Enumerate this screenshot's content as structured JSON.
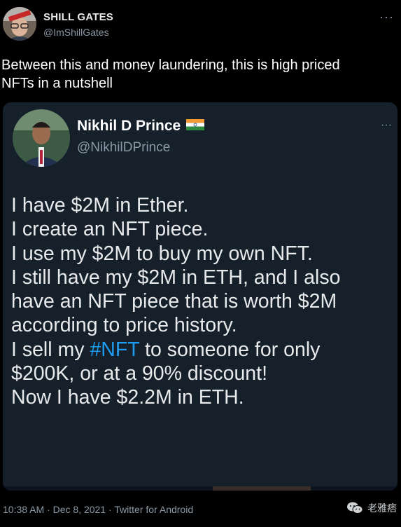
{
  "tweet": {
    "author_name": "SHILL GATES",
    "author_handle": "@ImShillGates",
    "text_lines": [
      "Between this and money laundering, this is high priced",
      "NFTs in a nutshell"
    ],
    "meta": "10:38 AM · Dec 8, 2021 · Twitter for Android"
  },
  "quoted": {
    "author_name": "Nikhil D Prince",
    "author_handle": "@NikhilDPrince",
    "line1": "I have $2M in Ether.",
    "line2": "I create an NFT piece.",
    "line3": "I use my $2M to buy my own NFT.",
    "line4": "I still have my $2M in ETH, and I also",
    "line5": "have an NFT piece that is worth $2M",
    "line6": "according to price history.",
    "line7_pre": "I sell my ",
    "line7_tag": "#NFT",
    "line7_post": " to someone for only",
    "line8": "$200K, or at a 90% discount!",
    "line9": "Now I have $2.2M in ETH."
  },
  "more_symbol": "···",
  "watermark": {
    "text": "老雅痞",
    "icon": "wechat-icon"
  },
  "colors": {
    "background": "#000000",
    "card": "#15202b",
    "hashtag": "#1d9bf0",
    "muted": "#8b98a5"
  }
}
